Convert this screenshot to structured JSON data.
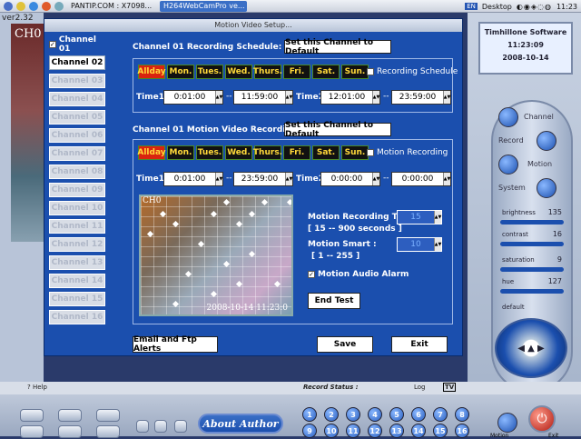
{
  "taskbar": {
    "tab_pantip": "PANTIP.COM : X7098...",
    "tab_webcam": "H264WebCamPro ve...",
    "lang": "EN",
    "desktop": "Desktop",
    "time": "11:23"
  },
  "app": {
    "version": "ver2.32",
    "ch_overlay": "CH0"
  },
  "dialog": {
    "title": "Motion Video Setup...",
    "channels": [
      "Channel 01",
      "Channel 02",
      "Channel 03",
      "Channel 04",
      "Channel 05",
      "Channel 06",
      "Channel 07",
      "Channel 08",
      "Channel 09",
      "Channel 10",
      "Channel 11",
      "Channel 12",
      "Channel 13",
      "Channel 14",
      "Channel 15",
      "Channel 16"
    ],
    "channel01_checked": true,
    "schedule": {
      "title": "Channel 01 Recording Schedule:",
      "default_btn": "Set this Channel to Default",
      "days": [
        "Allday",
        "Mon.",
        "Tues.",
        "Wed.",
        "Thurs.",
        "Fri.",
        "Sat.",
        "Sun."
      ],
      "checkbox_label": "Recording Schedule",
      "time1_label": "Time1:",
      "time1_start": "0:01:00",
      "time1_end": "11:59:00",
      "time2_label": "Time2:",
      "time2_start": "12:01:00",
      "time2_end": "23:59:00",
      "dash": "--"
    },
    "motion": {
      "title": "Channel 01 Motion Video Recording:",
      "default_btn": "Set this Channel to Default",
      "days": [
        "Allday",
        "Mon.",
        "Tues.",
        "Wed.",
        "Thurs.",
        "Fri.",
        "Sat.",
        "Sun."
      ],
      "checkbox_label": "Motion Recording",
      "time1_label": "Time1:",
      "time1_start": "0:01:00",
      "time1_end": "23:59:00",
      "time2_label": "Time2:",
      "time2_start": "0:00:00",
      "time2_end": "0:00:00",
      "dash": "--",
      "video_ch": "CH0",
      "video_timestamp": "2008-10-14 11:23:0",
      "rec_time_label": "Motion Recording Time",
      "rec_time_range": "[ 15 -- 900 seconds ]",
      "rec_time_value": "15",
      "smart_label": "Motion Smart :",
      "smart_range": "[ 1 -- 255 ]",
      "smart_value": "10",
      "audio_alarm_label": "Motion Audio Alarm",
      "audio_alarm_checked": true,
      "end_test_btn": "End Test"
    },
    "footer": {
      "email_btn": "Email and Ftp Alerts",
      "save_btn": "Save",
      "exit_btn": "Exit"
    }
  },
  "right_panel": {
    "brand": "Timhillone Software",
    "clock_time": "11:23:09",
    "clock_date": "2008-10-14",
    "channel_label": "Channel",
    "record_label": "Record",
    "motion_label": "Motion",
    "system_label": "System",
    "brightness_label": "brightness",
    "brightness_val": "135",
    "contrast_label": "contrast",
    "contrast_val": "16",
    "saturation_label": "saturation",
    "saturation_val": "9",
    "hue_label": "hue",
    "hue_val": "127",
    "default_label": "default"
  },
  "bottom": {
    "help": "Help",
    "record_status": "Record Status :",
    "log": "Log",
    "tv": "TV",
    "about": "About Author",
    "numbers": [
      "1",
      "2",
      "3",
      "4",
      "5",
      "6",
      "7",
      "8",
      "9",
      "10",
      "11",
      "12",
      "13",
      "14",
      "15",
      "16"
    ],
    "motion_label": "Motion",
    "exit_label": "Exit"
  }
}
